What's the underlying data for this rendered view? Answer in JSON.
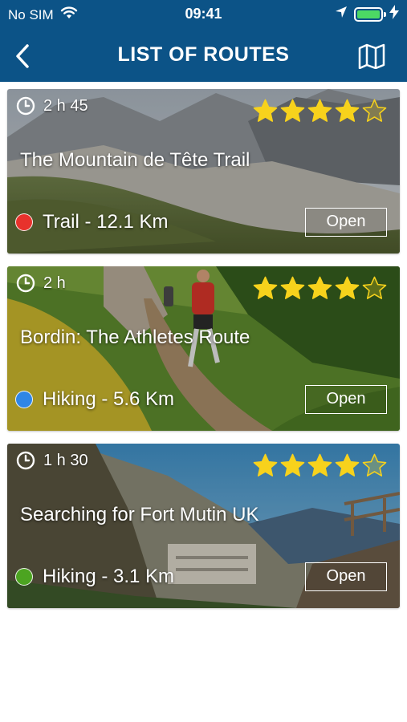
{
  "status": {
    "carrier": "No SIM",
    "time": "09:41"
  },
  "nav": {
    "title": "LIST OF ROUTES"
  },
  "routes": [
    {
      "duration": "2 h 45",
      "rating": 4,
      "max_rating": 5,
      "title": "The Mountain de Tête Trail",
      "info": "Trail - 12.1 Km",
      "dot_color": "#e8322c",
      "open_label": "Open"
    },
    {
      "duration": "2 h",
      "rating": 4,
      "max_rating": 5,
      "title": "Bordin: The Athletes Route",
      "info": "Hiking - 5.6 Km",
      "dot_color": "#2f86e6",
      "open_label": "Open"
    },
    {
      "duration": "1 h 30",
      "rating": 4,
      "max_rating": 5,
      "title": "Searching for Fort Mutin UK",
      "info": "Hiking - 3.1 Km",
      "dot_color": "#4ca421",
      "open_label": "Open"
    }
  ],
  "colors": {
    "header_bg": "#0c5387",
    "star_filled": "#f7d21c"
  }
}
